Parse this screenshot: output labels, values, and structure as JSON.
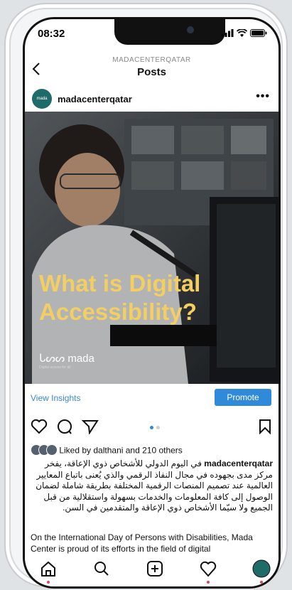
{
  "status": {
    "time": "08:32"
  },
  "nav": {
    "account": "MADACENTERQATAR",
    "title": "Posts"
  },
  "post": {
    "username": "madacenterqatar",
    "avatar_text": "mada",
    "headline_line1": "What is Digital",
    "headline_line2": "Accessibility?",
    "brand": "ᒐᔕᔕ mada",
    "brand_tagline": "Digital access for all",
    "view_insights": "View Insights",
    "promote": "Promote",
    "liked_by": "Liked by dalthani and 210 others",
    "caption_user": "madacenterqatar",
    "caption_ar": "في اليوم الدولي للأشخاص ذوي الإعاقة، يفخر مركز مدى بجهوده في مجال النفاذ الرقمي والذي يُعنى باتباع المعايير العالمية عند تصميم المنصات الرقمية المختلفة بطريقة شاملة لضمان الوصول إلى كافة المعلومات والخدمات بسهولة واستقلالية من قبل الجميع ولا سيّما الأشخاص ذوي الإعاقة والمتقدمين في السن.",
    "caption_en": "On the International Day of Persons with Disabilities, Mada Center is proud of its efforts in the field of digital"
  },
  "colors": {
    "headline": "#f3ce62",
    "accent": "#2f8bd9",
    "notification": "#e0455a"
  }
}
